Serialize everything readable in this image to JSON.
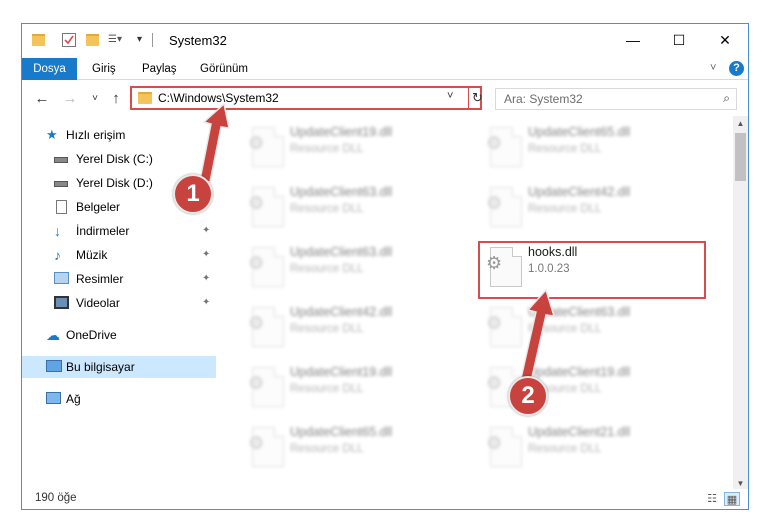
{
  "window": {
    "title": "System32",
    "minimize": "—",
    "maximize": "☐",
    "close": "✕"
  },
  "ribbon": {
    "tabs": [
      "Dosya",
      "Giriş",
      "Paylaş",
      "Görünüm"
    ],
    "expand_icon": "˅",
    "help": "?"
  },
  "nav": {
    "back": "←",
    "forward": "→",
    "recent": "˅",
    "up": "↑",
    "address": "C:\\Windows\\System32",
    "address_dropdown": "˅",
    "refresh": "↻",
    "search_placeholder": "Ara: System32",
    "search_icon": "⌕"
  },
  "sidebar": {
    "items": [
      {
        "label": "Hızlı erişim",
        "icon": "star-icon",
        "pinned": false
      },
      {
        "label": "Yerel Disk (C:)",
        "icon": "drive-icon",
        "pinned": false
      },
      {
        "label": "Yerel Disk (D:)",
        "icon": "drive-icon",
        "pinned": false
      },
      {
        "label": "Belgeler",
        "icon": "documents-icon",
        "pinned": false
      },
      {
        "label": "İndirmeler",
        "icon": "download-icon",
        "pinned": true
      },
      {
        "label": "Müzik",
        "icon": "music-icon",
        "pinned": true
      },
      {
        "label": "Resimler",
        "icon": "pictures-icon",
        "pinned": true
      },
      {
        "label": "Videolar",
        "icon": "video-icon",
        "pinned": true
      },
      {
        "label": "OneDrive",
        "icon": "cloud-icon",
        "pinned": false
      },
      {
        "label": "Bu bilgisayar",
        "icon": "computer-icon",
        "pinned": false
      },
      {
        "label": "Ağ",
        "icon": "network-icon",
        "pinned": false
      }
    ],
    "pin_glyph": "📌"
  },
  "files": [
    {
      "name": "UpdateClient19.dll",
      "sub": "Resource DLL",
      "blurred": true
    },
    {
      "name": "UpdateClient65.dll",
      "sub": "Resource DLL",
      "blurred": true
    },
    {
      "name": "UpdateClient63.dll",
      "sub": "Resource DLL",
      "blurred": true
    },
    {
      "name": "UpdateClient42.dll",
      "sub": "Resource DLL",
      "blurred": true
    },
    {
      "name": "UpdateClient63.dll",
      "sub": "Resource DLL",
      "blurred": true
    },
    {
      "name": "hooks.dll",
      "sub": "1.0.0.23",
      "blurred": false
    },
    {
      "name": "UpdateClient42.dll",
      "sub": "Resource DLL",
      "blurred": true
    },
    {
      "name": "UpdateClient63.dll",
      "sub": "Resource DLL",
      "blurred": true
    },
    {
      "name": "UpdateClient19.dll",
      "sub": "Resource DLL",
      "blurred": true
    },
    {
      "name": "UpdateClient19.dll",
      "sub": "Resource DLL",
      "blurred": true
    },
    {
      "name": "UpdateClient65.dll",
      "sub": "Resource DLL",
      "blurred": true
    },
    {
      "name": "UpdateClient21.dll",
      "sub": "Resource DLL",
      "blurred": true
    }
  ],
  "status": {
    "count": "190 öğe"
  },
  "callouts": [
    "1",
    "2"
  ],
  "colors": {
    "accent": "#1979ca",
    "highlight": "#d94c4c",
    "callout": "#c8423e",
    "selected": "#cce8ff"
  }
}
